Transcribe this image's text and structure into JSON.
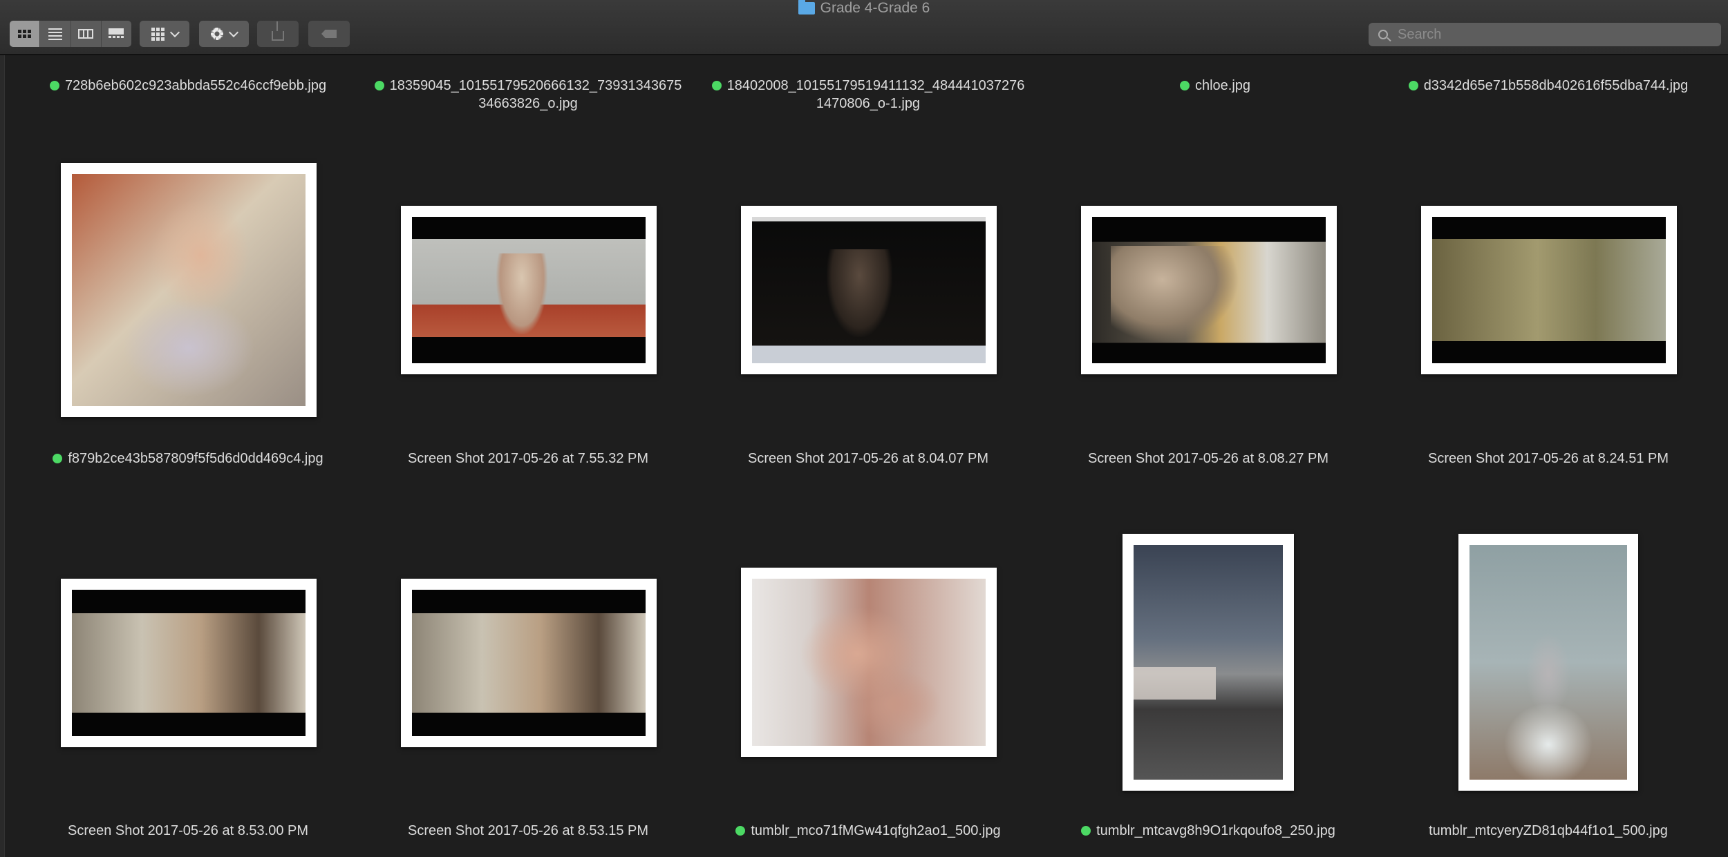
{
  "window": {
    "title": "Grade 4-Grade 6"
  },
  "toolbar": {
    "view_modes": [
      "icon-view",
      "list-view",
      "column-view",
      "gallery-view"
    ],
    "active_view": "icon-view",
    "group_icon": "grid-icon",
    "action_icon": "gear-icon",
    "share_icon": "share-icon",
    "tag_icon": "tag-icon"
  },
  "search": {
    "placeholder": "Search"
  },
  "colors": {
    "tag_green": "#4cd964",
    "background": "#1e1e1e"
  },
  "files": {
    "row0": [
      {
        "name": "728b6eb602c923abbda552c46ccf9ebb.jpg",
        "tagged": true
      },
      {
        "line1": "18359045_10155179520666132_73931343675",
        "line2": "34663826_o.jpg",
        "tagged": true
      },
      {
        "line1": "18402008_10155179519411132_484441037276",
        "line2": "1470806_o-1.jpg",
        "tagged": true
      },
      {
        "name": "chloe.jpg",
        "tagged": true
      },
      {
        "name": "d3342d65e71b558db402616f55dba744.jpg",
        "tagged": true
      }
    ],
    "row1": [
      {
        "name": "f879b2ce43b587809f5f5d6d0dd469c4.jpg",
        "tagged": true
      },
      {
        "name": "Screen Shot 2017-05-26 at 7.55.32 PM",
        "tagged": false
      },
      {
        "name": "Screen Shot 2017-05-26 at 8.04.07 PM",
        "tagged": false
      },
      {
        "name": "Screen Shot 2017-05-26 at 8.08.27 PM",
        "tagged": false
      },
      {
        "name": "Screen Shot 2017-05-26 at 8.24.51 PM",
        "tagged": false
      }
    ],
    "row2": [
      {
        "name": "Screen Shot 2017-05-26 at 8.53.00 PM",
        "tagged": false
      },
      {
        "name": "Screen Shot 2017-05-26 at 8.53.15 PM",
        "tagged": false
      },
      {
        "name": "tumblr_mco71fMGw41qfgh2ao1_500.jpg",
        "tagged": true
      },
      {
        "name": "tumblr_mtcavg8h9O1rkqoufo8_250.jpg",
        "tagged": true
      },
      {
        "name": "tumblr_mtcyeryZD81qb44f1o1_500.jpg",
        "tagged": false
      }
    ]
  }
}
